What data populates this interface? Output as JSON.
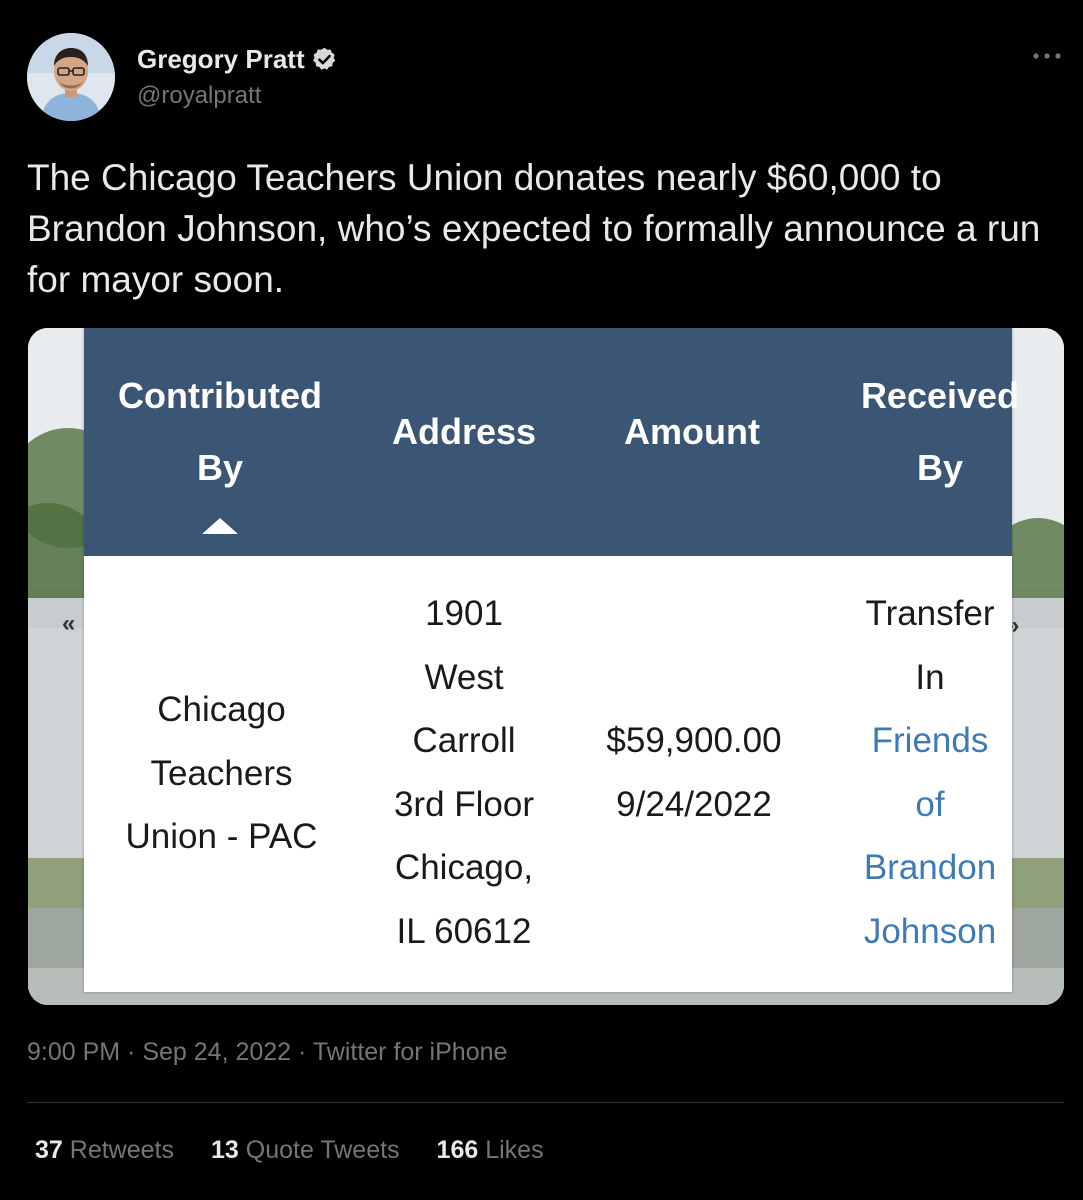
{
  "author": {
    "display_name": "Gregory Pratt",
    "handle": "@royalpratt"
  },
  "tweet": {
    "text": "The Chicago Teachers Union donates nearly $60,000 to Brandon Johnson, who’s expected to formally announce a run for mayor soon."
  },
  "media_table": {
    "headers": {
      "contributed_by": [
        "Contributed",
        "By"
      ],
      "address": "Address",
      "amount": "Amount",
      "received_by": [
        "Received",
        "By"
      ]
    },
    "row": {
      "contributor": [
        "Chicago",
        "Teachers",
        "Union - PAC"
      ],
      "address": [
        "1901",
        "West",
        "Carroll",
        "3rd Floor",
        "Chicago,",
        "IL 60612"
      ],
      "amount": [
        "$59,900.00",
        "9/24/2022"
      ],
      "received_type": [
        "Transfer",
        "In"
      ],
      "recipient": [
        "Friends",
        "of",
        "Brandon",
        "Johnson"
      ]
    },
    "link_color": "#3e7ab8",
    "header_color": "#3b5575"
  },
  "meta": {
    "time": "9:00 PM",
    "date": "Sep 24, 2022",
    "source": "Twitter for iPhone"
  },
  "stats": {
    "retweets_count": "37",
    "retweets_label": "Retweets",
    "quotes_count": "13",
    "quotes_label": "Quote Tweets",
    "likes_count": "166",
    "likes_label": "Likes"
  },
  "icons": {
    "verified": "verified-badge-icon",
    "more": "more-options-icon",
    "sort": "sort-ascending-icon"
  }
}
